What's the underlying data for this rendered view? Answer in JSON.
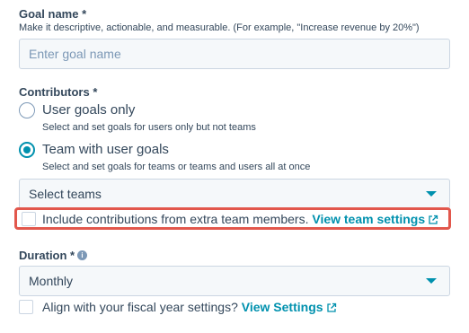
{
  "goal_name": {
    "label": "Goal name *",
    "help": "Make it descriptive, actionable, and measurable. (For example, \"Increase revenue by 20%\")",
    "placeholder": "Enter goal name"
  },
  "contributors": {
    "label": "Contributors *",
    "options": [
      {
        "label": "User goals only",
        "help": "Select and set goals for users only but not teams",
        "checked": false
      },
      {
        "label": "Team with user goals",
        "help": "Select and set goals for teams or teams and users all at once",
        "checked": true
      }
    ],
    "select_teams": "Select teams",
    "include_contributions": {
      "text": "Include contributions from extra team members.",
      "link": "View team settings",
      "checked": false
    }
  },
  "duration": {
    "label": "Duration *",
    "info_icon": "i",
    "value": "Monthly",
    "fiscal": {
      "text": "Align with your fiscal year settings?",
      "link": "View Settings",
      "checked": false
    }
  },
  "colors": {
    "accent": "#0091ae",
    "highlight": "#e2574c",
    "text": "#33475b"
  }
}
